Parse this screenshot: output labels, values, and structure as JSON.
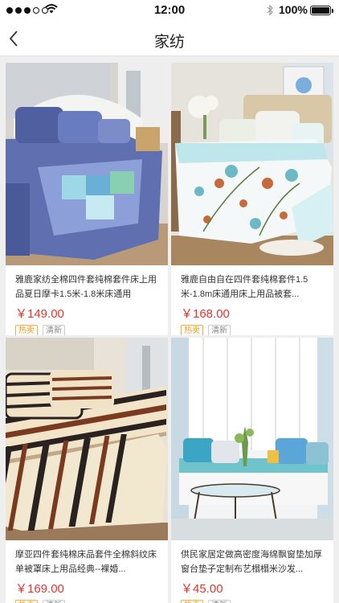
{
  "status_bar": {
    "time": "12:00",
    "battery": "100%"
  },
  "nav": {
    "title": "家纺"
  },
  "products": [
    {
      "title": "雅鹿家纺全棉四件套纯棉套件床上用品夏日摩卡1.5米-1.8米床通用",
      "price": "￥149.00",
      "tags": [
        "热卖",
        "清新"
      ]
    },
    {
      "title": "雅鹿自由自在四件套纯棉套件1.5米-1.8m床通用床上用品被套...",
      "price": "￥168.00",
      "tags": [
        "热卖",
        "清新"
      ]
    },
    {
      "title": "摩亚四件套纯棉床品套件全棉斜纹床单被罩床上用品经典--裸婚...",
      "price": "￥169.00",
      "tags": [
        "热卖",
        "清新"
      ]
    },
    {
      "title": "供民家居定做高密度海绵飘窗垫加厚窗台垫子定制布艺榻榻米沙发...",
      "price": "￥45.00",
      "tags": [
        "热卖",
        "清新"
      ]
    }
  ],
  "colors": {
    "price": "#e5342c",
    "hot_tag": "#f09a1a",
    "plain_tag": "#888888"
  },
  "icons": {
    "back": "chevron-left-icon",
    "wifi": "wifi-icon",
    "bluetooth": "bluetooth-icon",
    "battery": "battery-icon"
  }
}
